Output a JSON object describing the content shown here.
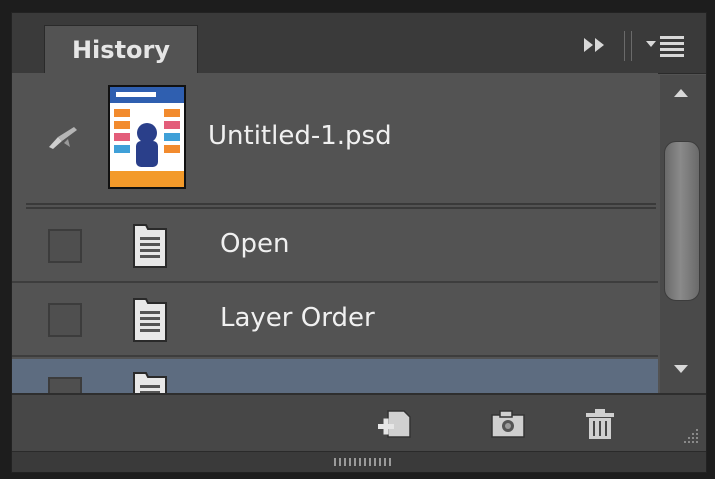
{
  "panel": {
    "tab_label": "History",
    "collapse_icon": "double-arrow-right-icon",
    "menu_icon": "panel-menu-icon"
  },
  "snapshot": {
    "label": "Untitled-1.psd",
    "source_icon": "history-brush-icon",
    "thumbnail": "document-thumbnail"
  },
  "states": [
    {
      "label": "Open",
      "icon": "history-state-icon",
      "selected": false
    },
    {
      "label": "Layer Order",
      "icon": "history-state-icon",
      "selected": false
    },
    {
      "label": "",
      "icon": "history-state-icon",
      "selected": true
    }
  ],
  "footer": {
    "buttons": [
      "create-new-document-icon",
      "snapshot-camera-icon",
      "trash-icon"
    ]
  },
  "colors": {
    "panel_bg": "#535353",
    "header_bg": "#3a3a3a",
    "selected_row": "#5d6c80",
    "text": "#f0f0f0"
  }
}
